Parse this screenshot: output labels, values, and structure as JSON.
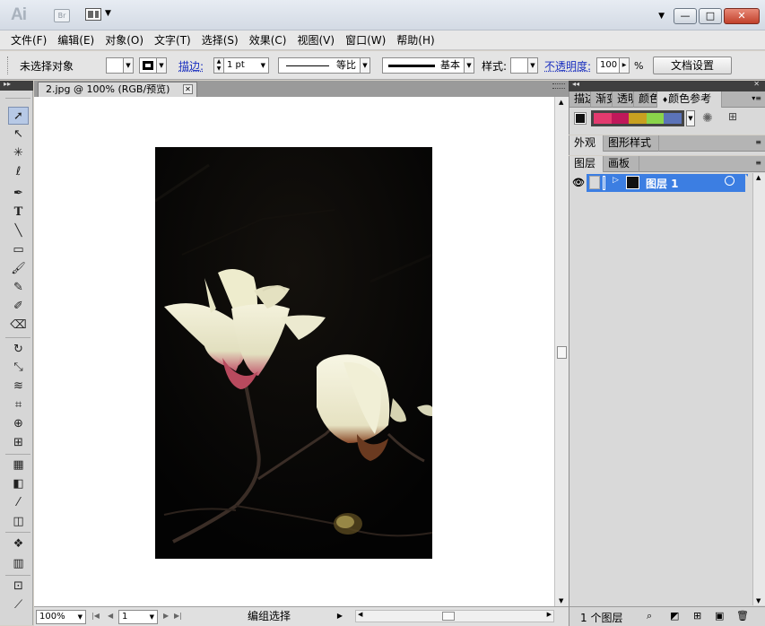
{
  "app": {
    "logo_text": "Ai",
    "bridge_label": "Br",
    "window_controls": [
      "▼",
      "—",
      "□",
      "✕"
    ]
  },
  "menu": {
    "items": [
      "文件(F)",
      "编辑(E)",
      "对象(O)",
      "文字(T)",
      "选择(S)",
      "效果(C)",
      "视图(V)",
      "窗口(W)",
      "帮助(H)"
    ]
  },
  "control": {
    "selection_status": "未选择对象",
    "stroke_label": "描边:",
    "stroke_weight": "1 pt",
    "profile_label": "等比",
    "brush_label": "基本",
    "style_label": "样式:",
    "opacity_label": "不透明度:",
    "opacity_value": "100",
    "opacity_unit": "%",
    "doc_setup_button": "文档设置"
  },
  "document": {
    "tab_title": "2.jpg @ 100% (RGB/预览)"
  },
  "status": {
    "zoom": "100%",
    "artboard": "1",
    "mode": "编组选择"
  },
  "panels": {
    "top_tabs": [
      "描边",
      "渐变",
      "透明",
      "颜色",
      "颜色参考"
    ],
    "harmony_colors": [
      "#e23a6e",
      "#c0185a",
      "#c8a020",
      "#8ad44a",
      "#5b73b8"
    ],
    "appearance_tabs": [
      "外观",
      "图形样式"
    ],
    "layers_tabs": [
      "图层",
      "画板"
    ],
    "layer_name": "图层 1",
    "layer_count": "1 个图层"
  },
  "colors": {
    "layer_selected": "#3c7ee2",
    "canvas_bg": "#ffffff"
  }
}
